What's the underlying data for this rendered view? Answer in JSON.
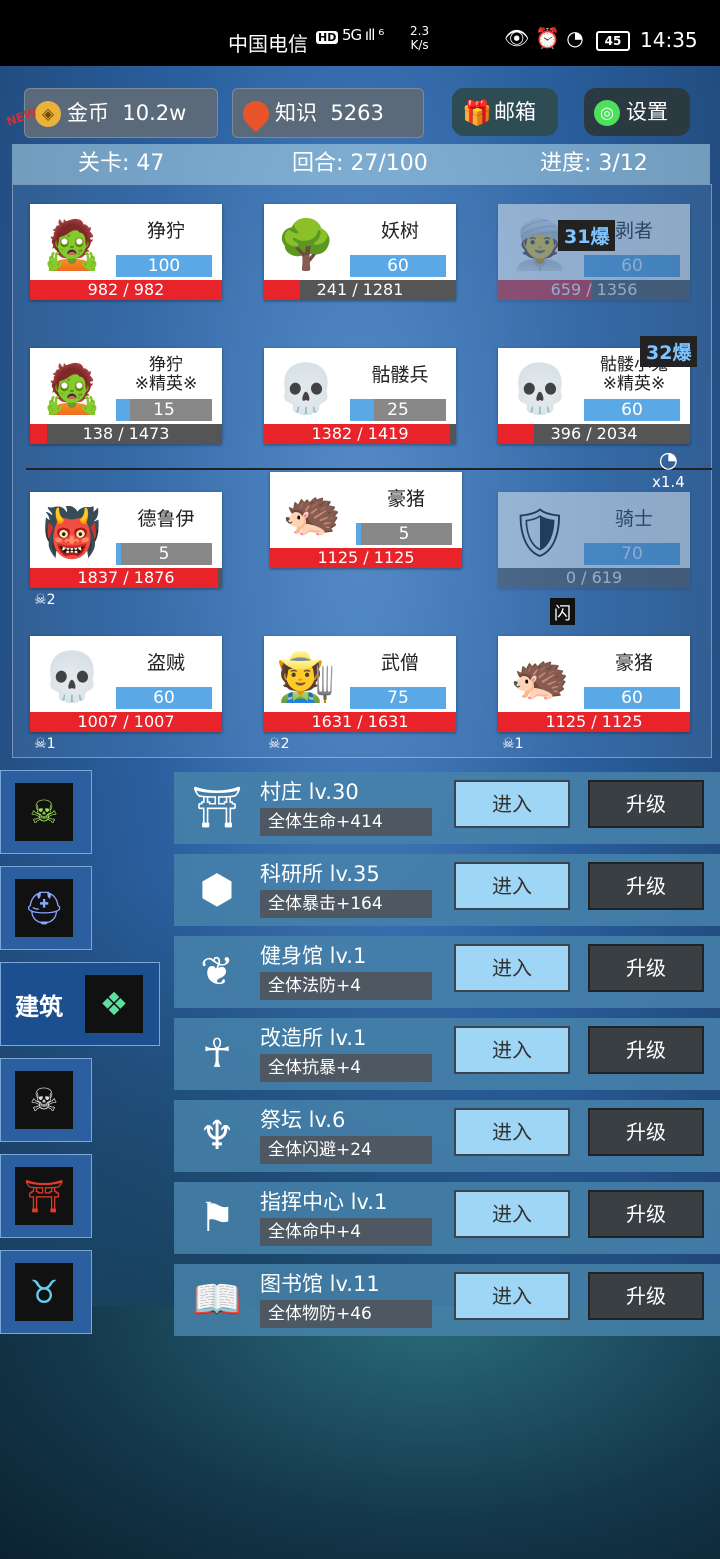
{
  "status_bar": {
    "carrier": "中国电信",
    "hd": "HD",
    "signal": "5G ıll ⁶",
    "net_speed_value": "2.3",
    "net_speed_unit": "K/s",
    "battery": "45",
    "time": "14:35"
  },
  "top": {
    "gold_label": "金币",
    "gold_value": "10.2w",
    "knowledge_label": "知识",
    "knowledge_value": "5263",
    "mail_label": "邮箱",
    "settings_label": "设置",
    "new_badge": "NEW"
  },
  "info": {
    "stage": "关卡: 47",
    "round": "回合: 27/100",
    "progress": "进度: 3/12"
  },
  "enemies": [
    {
      "name": "狰狞",
      "level": "100",
      "hp": "982 / 982",
      "level_frac": 1.0,
      "hp_frac": 1.0,
      "icon": "zombie-icon",
      "glyph": "🧟"
    },
    {
      "name": "妖树",
      "level": "60",
      "hp": "241 / 1281",
      "level_frac": 1.0,
      "hp_frac": 0.19,
      "icon": "tree-monster-icon",
      "glyph": "🌳"
    },
    {
      "name": "剥者",
      "level": "60",
      "hp": "659 / 1356",
      "level_frac": 1.0,
      "hp_frac": 0.49,
      "icon": "mummy-icon",
      "glyph": "👳"
    },
    {
      "name": "狰狞\n※精英※",
      "level": "15",
      "hp": "138 / 1473",
      "level_frac": 0.15,
      "hp_frac": 0.09,
      "icon": "zombie-elite-icon",
      "glyph": "🧟"
    },
    {
      "name": "骷髅兵",
      "level": "25",
      "hp": "1382 / 1419",
      "level_frac": 0.25,
      "hp_frac": 0.97,
      "icon": "skeleton-soldier-icon",
      "glyph": "💀"
    },
    {
      "name": "骷髅小鬼\n※精英※",
      "level": "60",
      "hp": "396 / 2034",
      "level_frac": 1.0,
      "hp_frac": 0.19,
      "icon": "skull-imp-icon",
      "glyph": "💀"
    }
  ],
  "allies": [
    {
      "name": "德鲁伊",
      "level": "5",
      "hp": "1837 / 1876",
      "level_frac": 0.05,
      "hp_frac": 0.98,
      "icon": "druid-icon",
      "glyph": "👹",
      "deaths": "2"
    },
    {
      "name": "豪猪",
      "level": "5",
      "hp": "1125 / 1125",
      "level_frac": 0.05,
      "hp_frac": 1.0,
      "icon": "porcupine-icon",
      "glyph": "🦔"
    },
    {
      "name": "骑士",
      "level": "70",
      "hp": "0 / 619",
      "level_frac": 1.0,
      "hp_frac": 0.0,
      "icon": "knight-icon",
      "glyph": "🛡"
    },
    {
      "name": "盗贼",
      "level": "60",
      "hp": "1007 / 1007",
      "level_frac": 1.0,
      "hp_frac": 1.0,
      "icon": "reaper-icon",
      "glyph": "💀",
      "deaths": "1"
    },
    {
      "name": "武僧",
      "level": "75",
      "hp": "1631 / 1631",
      "level_frac": 1.0,
      "hp_frac": 1.0,
      "icon": "monk-icon",
      "glyph": "🧑‍🌾",
      "deaths": "2"
    },
    {
      "name": "豪猪",
      "level": "60",
      "hp": "1125 / 1125",
      "level_frac": 1.0,
      "hp_frac": 1.0,
      "icon": "porcupine-icon",
      "glyph": "🦔",
      "deaths": "1"
    }
  ],
  "crit_tags": [
    "31爆",
    "32爆"
  ],
  "speed": "x1.4",
  "flash_tag": "闪",
  "tabs": {
    "active_label": "建筑"
  },
  "buildings": [
    {
      "name": "村庄 lv.30",
      "stat": "全体生命+414",
      "icon": "village-gate-icon",
      "glyph": "⛩"
    },
    {
      "name": "科研所 lv.35",
      "stat": "全体暴击+164",
      "icon": "research-cube-icon",
      "glyph": "⬢"
    },
    {
      "name": "健身馆 lv.1",
      "stat": "全体法防+4",
      "icon": "gym-icon",
      "glyph": "❦"
    },
    {
      "name": "改造所 lv.1",
      "stat": "全体抗暴+4",
      "icon": "remodel-icon",
      "glyph": "☥"
    },
    {
      "name": "祭坛 lv.6",
      "stat": "全体闪避+24",
      "icon": "altar-icon",
      "glyph": "♆"
    },
    {
      "name": "指挥中心 lv.1",
      "stat": "全体命中+4",
      "icon": "command-banner-icon",
      "glyph": "⚑"
    },
    {
      "name": "图书馆 lv.11",
      "stat": "全体物防+46",
      "icon": "library-book-icon",
      "glyph": "📖"
    }
  ],
  "enter_label": "进入",
  "upgrade_label": "升级"
}
